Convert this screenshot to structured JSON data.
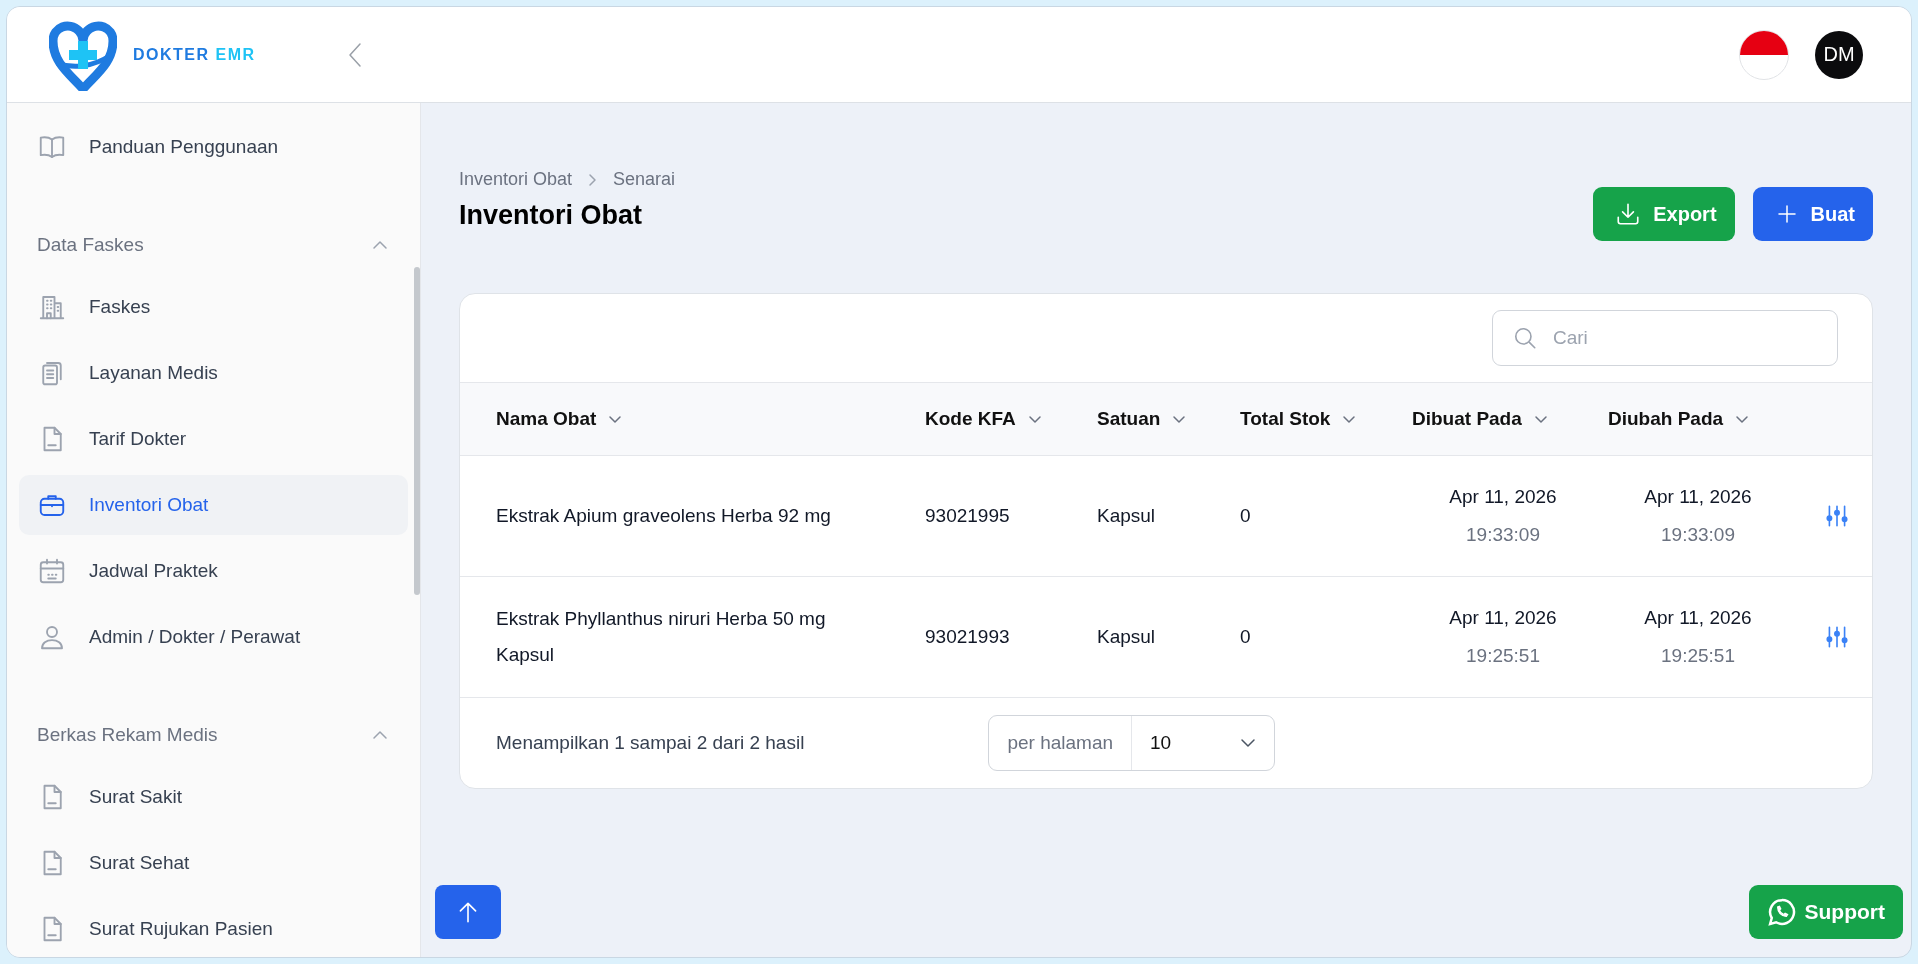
{
  "header": {
    "logo": {
      "word_a": "DOKTER",
      "word_b": "EMR"
    },
    "avatar": "DM"
  },
  "sidebar": {
    "items": [
      {
        "kind": "item",
        "label": "Panduan Penggunaan",
        "selected": false
      },
      {
        "kind": "section",
        "label": "Data Faskes",
        "expanded": true
      },
      {
        "kind": "item",
        "label": "Faskes",
        "selected": false
      },
      {
        "kind": "item",
        "label": "Layanan Medis",
        "selected": false
      },
      {
        "kind": "item",
        "label": "Tarif Dokter",
        "selected": false
      },
      {
        "kind": "item",
        "label": "Inventori Obat",
        "selected": true
      },
      {
        "kind": "item",
        "label": "Jadwal Praktek",
        "selected": false
      },
      {
        "kind": "item",
        "label": "Admin / Dokter / Perawat",
        "selected": false
      },
      {
        "kind": "section",
        "label": "Berkas Rekam Medis",
        "expanded": true
      },
      {
        "kind": "item",
        "label": "Surat Sakit",
        "selected": false
      },
      {
        "kind": "item",
        "label": "Surat Sehat",
        "selected": false
      },
      {
        "kind": "item",
        "label": "Surat Rujukan Pasien",
        "selected": false
      }
    ]
  },
  "breadcrumb": [
    "Inventori Obat",
    "Senarai"
  ],
  "title": "Inventori Obat",
  "actions": [
    {
      "kind": "export",
      "label": "Export"
    },
    {
      "kind": "create",
      "label": "Buat"
    }
  ],
  "search": {
    "placeholder": "Cari"
  },
  "table": {
    "columns": [
      "Nama Obat",
      "Kode KFA",
      "Satuan",
      "Total Stok",
      "Dibuat Pada",
      "Diubah Pada"
    ],
    "rows": [
      {
        "name": "Ekstrak Apium graveolens Herba 92 mg",
        "code": "93021995",
        "unit": "Kapsul",
        "stock": "0",
        "created": {
          "date": "Apr 11, 2026",
          "time": "19:33:09"
        },
        "updated": {
          "date": "Apr 11, 2026",
          "time": "19:33:09"
        }
      },
      {
        "name": "Ekstrak Phyllanthus niruri Herba 50 mg Kapsul",
        "code": "93021993",
        "unit": "Kapsul",
        "stock": "0",
        "created": {
          "date": "Apr 11, 2026",
          "time": "19:25:51"
        },
        "updated": {
          "date": "Apr 11, 2026",
          "time": "19:25:51"
        }
      }
    ]
  },
  "pagination": {
    "summary": "Menampilkan 1 sampai 2 dari 2 hasil",
    "per_page_label": "per halaman",
    "per_page": "10"
  },
  "support": {
    "label": "Support"
  }
}
